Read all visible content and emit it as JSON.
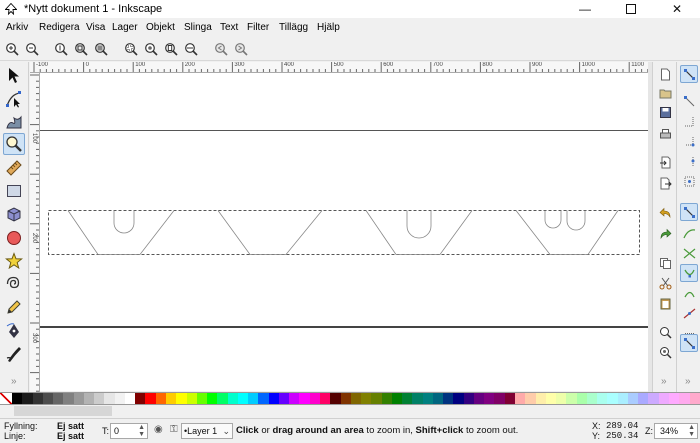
{
  "window": {
    "title": "*Nytt dokument 1 - Inkscape",
    "minimize_icon": "minimize-icon",
    "maximize_icon": "maximize-icon",
    "close_icon": "close-icon"
  },
  "menu": [
    "Arkiv",
    "Redigera",
    "Visa",
    "Lager",
    "Objekt",
    "Slinga",
    "Text",
    "Filter",
    "Tillägg",
    "Hjälp"
  ],
  "commands": {
    "zoom_icons": [
      "zoom-in-icon",
      "zoom-out-icon",
      "zoom-1to1-icon",
      "zoom-1to2-icon",
      "zoom-2to1-icon",
      "zoom-selection-icon",
      "zoom-drawing-icon",
      "zoom-page-icon",
      "zoom-page-width-icon",
      "zoom-prev-icon",
      "zoom-next-icon"
    ]
  },
  "tools": [
    "selector-tool",
    "node-tool",
    "tweak-tool",
    "zoom-tool",
    "measure-tool",
    "rectangle-tool",
    "3dbox-tool",
    "ellipse-tool",
    "star-tool",
    "spiral-tool",
    "pencil-tool",
    "pen-tool",
    "calligraphy-tool"
  ],
  "active_tool": "zoom-tool",
  "overflow_glyph": "»",
  "ruler": {
    "h_labels": [
      "-100",
      "0",
      "100",
      "200",
      "300",
      "400",
      "500",
      "600",
      "700",
      "800",
      "900",
      "1000",
      "1100",
      "1200"
    ],
    "v_labels": [
      "100",
      "200",
      "300"
    ]
  },
  "palette": {
    "colors": [
      "#000000",
      "#1a1a1a",
      "#333333",
      "#4d4d4d",
      "#666666",
      "#808080",
      "#999999",
      "#b3b3b3",
      "#cccccc",
      "#e6e6e6",
      "#f2f2f2",
      "#ffffff",
      "#800000",
      "#ff0000",
      "#ff6600",
      "#ffcc00",
      "#ffff00",
      "#ccff00",
      "#66ff00",
      "#00ff00",
      "#00ff66",
      "#00ffcc",
      "#00ffff",
      "#00ccff",
      "#0066ff",
      "#0000ff",
      "#6600ff",
      "#cc00ff",
      "#ff00ff",
      "#ff00cc",
      "#ff0066",
      "#550000",
      "#803300",
      "#806600",
      "#808000",
      "#668000",
      "#338000",
      "#008000",
      "#008033",
      "#008066",
      "#008080",
      "#006680",
      "#003380",
      "#000080",
      "#330080",
      "#660080",
      "#800080",
      "#800066",
      "#800033",
      "#ffaaaa",
      "#ffccaa",
      "#ffeeaa",
      "#ffffaa",
      "#eeffaa",
      "#ccffaa",
      "#aaffaa",
      "#aaffcc",
      "#aaffee",
      "#aaffff",
      "#aaeeff",
      "#aaccff",
      "#aaaaff",
      "#ccaaff",
      "#eeaaff",
      "#ffaaff",
      "#ffaaee",
      "#ffaacc"
    ]
  },
  "status": {
    "fill_label": "Fyllning:",
    "stroke_label": "Linje:",
    "fill_value": "Ej satt",
    "stroke_value": "Ej satt",
    "opacity_label": "T:",
    "opacity_value": "0",
    "layer": "•Layer 1",
    "message_b1": "Click",
    "message_t1": " or ",
    "message_b2": "drag around an area",
    "message_t2": " to zoom in, ",
    "message_b3": "Shift+click",
    "message_t3": " to zoom out.",
    "x_label": "X:",
    "y_label": "Y:",
    "x_value": "289.04",
    "y_value": "250.34",
    "z_label": "Z:",
    "zoom_value": "34%"
  }
}
